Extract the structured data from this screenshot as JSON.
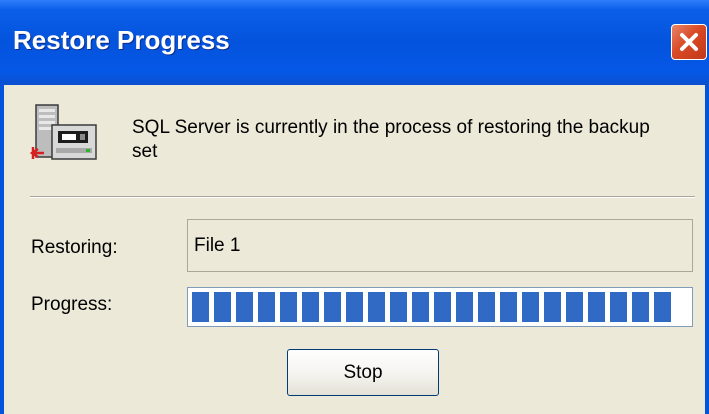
{
  "window": {
    "title": "Restore Progress",
    "close_icon": "close-x-icon"
  },
  "message": {
    "icon": "sql-server-backup-icon",
    "text": "SQL Server is currently in the process of restoring the backup set"
  },
  "restoring": {
    "label": "Restoring:",
    "value": "File 1"
  },
  "progress": {
    "label": "Progress:",
    "percent": 100
  },
  "buttons": {
    "stop": "Stop"
  },
  "colors": {
    "title_bar": "#0453dd",
    "progress_fill": "#316ac5",
    "close_button": "#d94a25",
    "dialog_bg": "#ece9d8"
  }
}
